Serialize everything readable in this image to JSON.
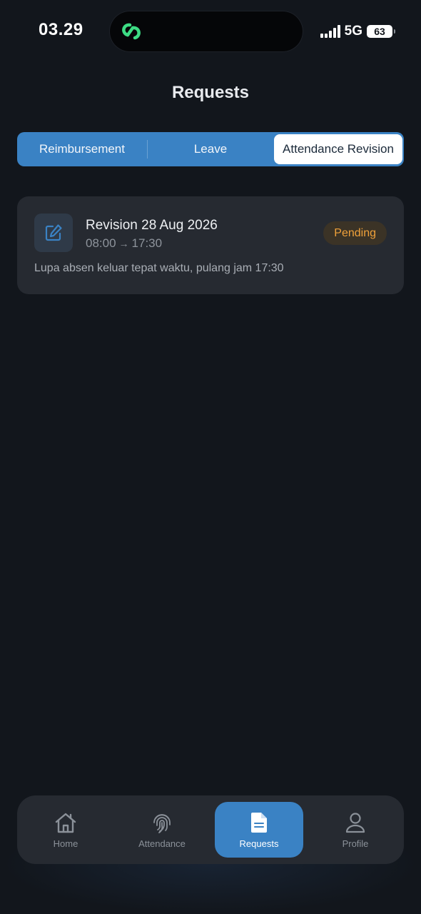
{
  "status_bar": {
    "time": "03.29",
    "network": "5G",
    "battery": "63"
  },
  "header": {
    "title": "Requests"
  },
  "tabs": [
    {
      "label": "Reimbursement",
      "active": false
    },
    {
      "label": "Leave",
      "active": false
    },
    {
      "label": "Attendance Revision",
      "active": true
    }
  ],
  "requests": [
    {
      "title": "Revision 28 Aug 2026",
      "time_from": "08:00",
      "time_to": "17:30",
      "status": "Pending",
      "description": "Lupa absen keluar tepat waktu, pulang jam 17:30",
      "icon": "edit-icon"
    }
  ],
  "bottom_nav": [
    {
      "label": "Home",
      "icon": "home-icon",
      "active": false
    },
    {
      "label": "Attendance",
      "icon": "fingerprint-icon",
      "active": false
    },
    {
      "label": "Requests",
      "icon": "document-icon",
      "active": true
    },
    {
      "label": "Profile",
      "icon": "user-icon",
      "active": false
    }
  ],
  "colors": {
    "background": "#12161c",
    "card": "#262a31",
    "accent": "#3a82c4",
    "pending": "#f0a13a",
    "island_icon": "#3ddc84"
  }
}
